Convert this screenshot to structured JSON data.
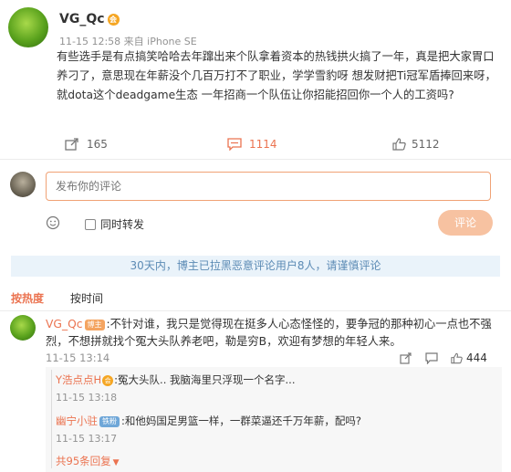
{
  "post": {
    "author": "VG_Qc",
    "meta": "11-15 12:58 来自 iPhone SE",
    "content": "有些选手是有点搞笑哈哈去年蹿出来个队拿着资本的热钱拱火搞了一年，真是把大家胃口养刁了，意思现在年薪没个几百万打不了职业，学学雪豹呀 想发财把Ti冠军盾捧回来呀，就dota这个deadgame生态 一年招商一个队伍让你招能招回你一个人的工资吗?",
    "actions": {
      "repost_count": "165",
      "comment_count": "1114",
      "like_count": "5112"
    },
    "colors": {
      "accent": "#eb7350",
      "author": "#333333"
    }
  },
  "composer": {
    "placeholder": "发布你的评论",
    "also_repost_label": "同时转发",
    "submit_label": "评论"
  },
  "notice": {
    "text": "30天内，博主已拉黑恶意评论用户8人，请谨慎评论"
  },
  "sort_tabs": [
    {
      "label": "按热度",
      "active": true
    },
    {
      "label": "按时间",
      "active": false
    }
  ],
  "comments": [
    {
      "author": "VG_Qc",
      "author_tag": "博主",
      "text": ":不针对谁，我只是觉得现在挺多人心态怪怪的，要争冠的那种初心一点也不强烈，不想拼就找个冤大头队养老吧，勒是穷B，欢迎有梦想的年轻人来。",
      "time": "11-15 13:14",
      "like_count": "444",
      "replies": [
        {
          "author": "Y浩点点H",
          "text": ":冤大头队.. 我脑海里只浮现一个名字...",
          "time": "11-15 13:18"
        },
        {
          "author": "幽宁小驻",
          "author_tag": "铁粉",
          "text": ":和他妈国足男篮一样，一群菜逼还千万年薪，配吗?",
          "time": "11-15 13:17"
        }
      ],
      "more_replies": "共95条回复"
    }
  ]
}
